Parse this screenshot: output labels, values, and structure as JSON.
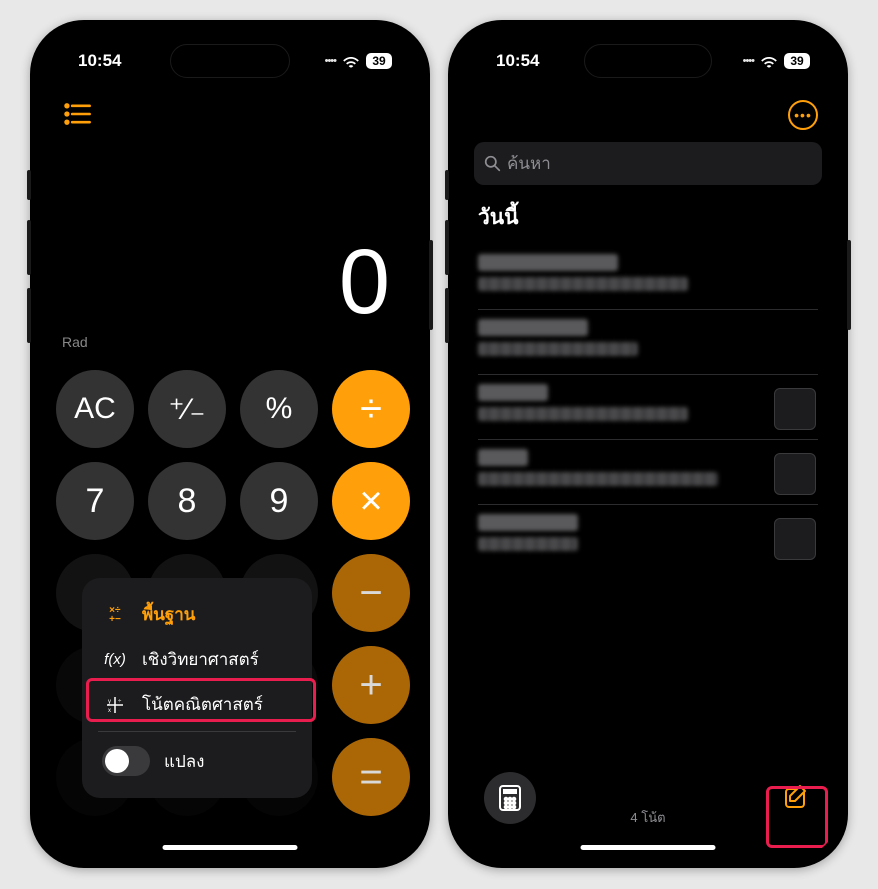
{
  "status": {
    "time": "10:54",
    "battery": "39"
  },
  "calculator": {
    "display": "0",
    "rad": "Rad",
    "keys": {
      "ac": "AC",
      "pm": "⁺⁄₋",
      "pct": "%",
      "div": "÷",
      "k7": "7",
      "k8": "8",
      "k9": "9",
      "mul": "×",
      "minus": "−",
      "plus": "+",
      "eq": "="
    },
    "modes": {
      "basic": "พื้นฐาน",
      "scientific": "เชิงวิทยาศาสตร์",
      "mathnotes": "โน้ตคณิตศาสตร์",
      "convert": "แปลง",
      "basic_icon": "✕÷\n+−",
      "sci_icon": "f(x)"
    }
  },
  "notes": {
    "search_placeholder": "ค้นหา",
    "section": "วันนี้",
    "count_label": "4 โน้ต"
  }
}
